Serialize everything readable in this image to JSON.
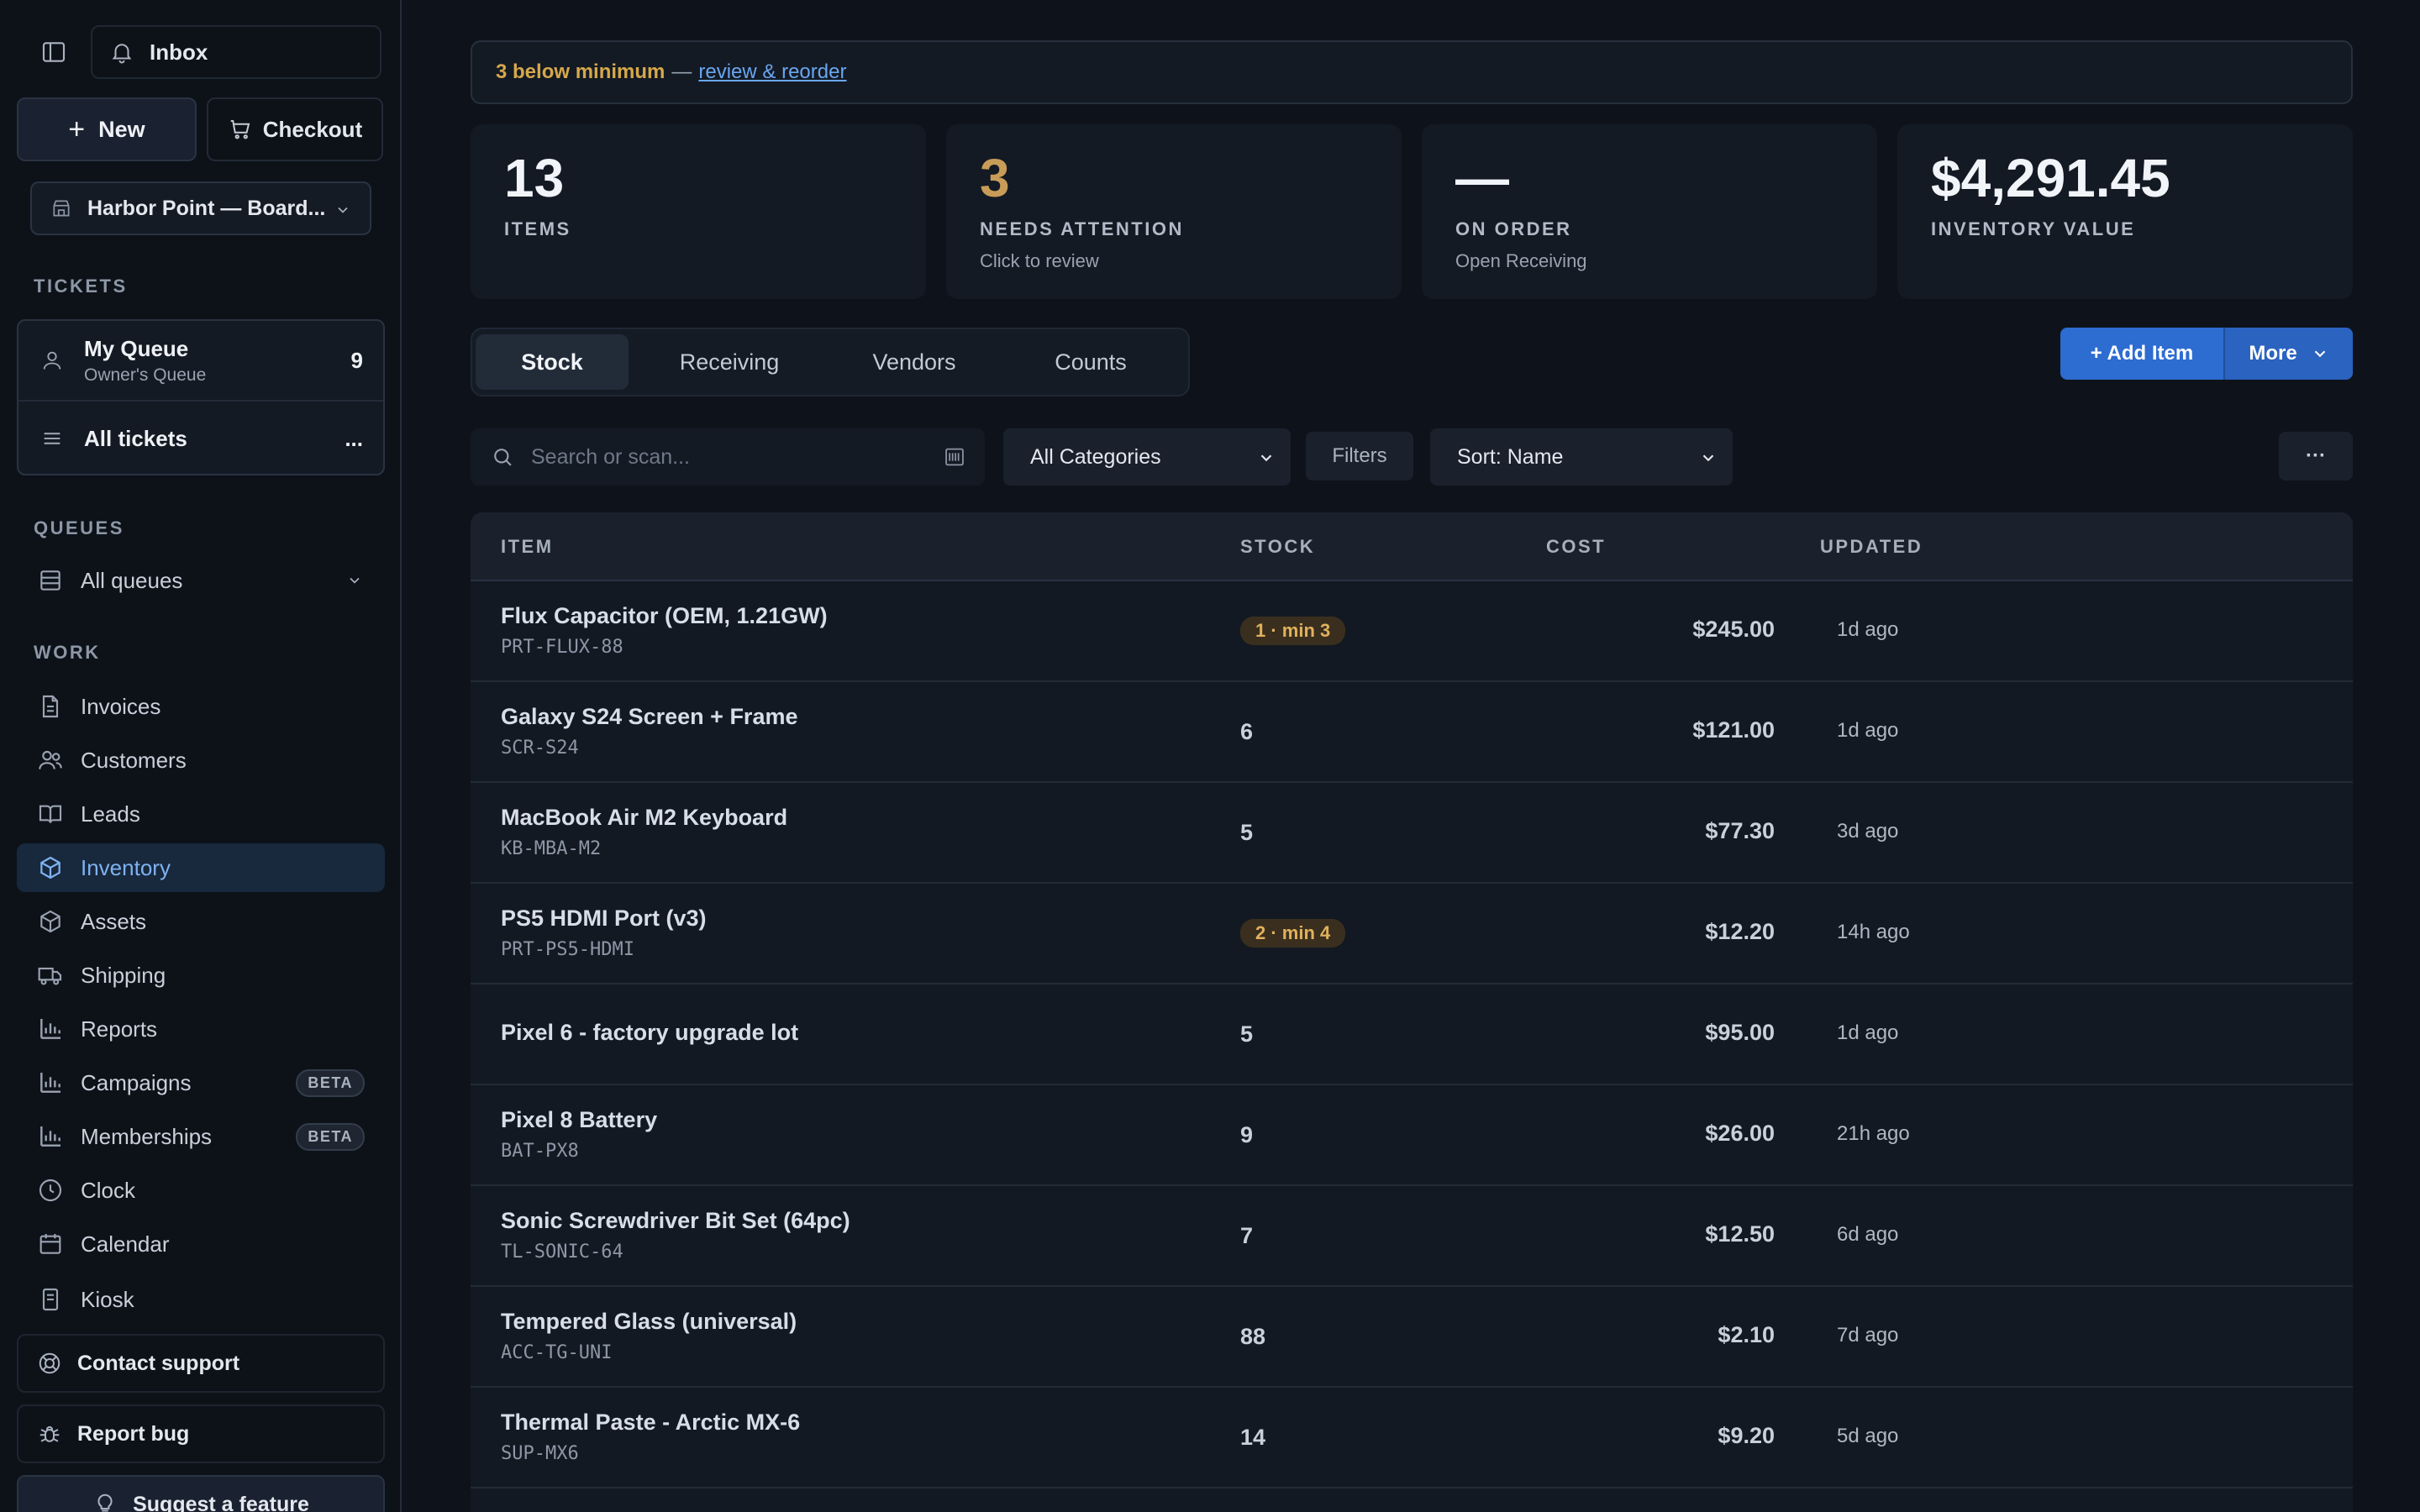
{
  "sidebar": {
    "inbox_label": "Inbox",
    "new_label": "New",
    "checkout_label": "Checkout",
    "location_label": "Harbor Point — Board...",
    "tickets_heading": "TICKETS",
    "my_queue": {
      "title": "My Queue",
      "subtitle": "Owner's Queue",
      "count": "9"
    },
    "all_tickets": {
      "label": "All tickets",
      "more": "..."
    },
    "queues_heading": "QUEUES",
    "all_queues_label": "All queues",
    "work_heading": "WORK",
    "nav": [
      {
        "label": "Invoices",
        "icon": "file-icon"
      },
      {
        "label": "Customers",
        "icon": "users-icon"
      },
      {
        "label": "Leads",
        "icon": "book-open-icon"
      },
      {
        "label": "Inventory",
        "icon": "box-icon",
        "active": true
      },
      {
        "label": "Assets",
        "icon": "cube-icon"
      },
      {
        "label": "Shipping",
        "icon": "truck-icon"
      },
      {
        "label": "Reports",
        "icon": "bar-chart-icon"
      },
      {
        "label": "Campaigns",
        "icon": "bar-chart-icon",
        "badge": "BETA"
      },
      {
        "label": "Memberships",
        "icon": "bar-chart-icon",
        "badge": "BETA"
      },
      {
        "label": "Clock",
        "icon": "clock-icon"
      },
      {
        "label": "Calendar",
        "icon": "calendar-icon"
      },
      {
        "label": "Kiosk",
        "icon": "tablet-icon"
      }
    ],
    "contact_support": "Contact support",
    "report_bug": "Report bug",
    "suggest_feature": "Suggest a feature"
  },
  "alert": {
    "warning": "3 below minimum",
    "separator": "—",
    "link": "review & reorder"
  },
  "stats": [
    {
      "value": "13",
      "label": "ITEMS",
      "sub": ""
    },
    {
      "value": "3",
      "label": "NEEDS ATTENTION",
      "sub": "Click to review"
    },
    {
      "value": "—",
      "label": "ON ORDER",
      "sub": "Open Receiving"
    },
    {
      "value": "$4,291.45",
      "label": "INVENTORY VALUE",
      "sub": ""
    }
  ],
  "tabs": [
    {
      "label": "Stock",
      "active": true
    },
    {
      "label": "Receiving"
    },
    {
      "label": "Vendors"
    },
    {
      "label": "Counts"
    }
  ],
  "actions": {
    "add_item": "+ Add Item",
    "more": "More"
  },
  "toolbar": {
    "search_placeholder": "Search or scan...",
    "category": "All Categories",
    "filters": "Filters",
    "sort": "Sort: Name",
    "overflow": "···"
  },
  "table": {
    "headers": {
      "item": "ITEM",
      "stock": "STOCK",
      "cost": "COST",
      "updated": "UPDATED"
    },
    "rows": [
      {
        "name": "Flux Capacitor (OEM, 1.21GW)",
        "sku": "PRT-FLUX-88",
        "stock": "1 · min 3",
        "low": true,
        "cost": "$245.00",
        "updated": "1d ago"
      },
      {
        "name": "Galaxy S24 Screen + Frame",
        "sku": "SCR-S24",
        "stock": "6",
        "cost": "$121.00",
        "updated": "1d ago"
      },
      {
        "name": "MacBook Air M2 Keyboard",
        "sku": "KB-MBA-M2",
        "stock": "5",
        "cost": "$77.30",
        "updated": "3d ago"
      },
      {
        "name": "PS5 HDMI Port (v3)",
        "sku": "PRT-PS5-HDMI",
        "stock": "2 · min 4",
        "low": true,
        "cost": "$12.20",
        "updated": "14h ago"
      },
      {
        "name": "Pixel 6 - factory upgrade lot",
        "sku": "",
        "stock": "5",
        "cost": "$95.00",
        "updated": "1d ago"
      },
      {
        "name": "Pixel 8 Battery",
        "sku": "BAT-PX8",
        "stock": "9",
        "cost": "$26.00",
        "updated": "21h ago"
      },
      {
        "name": "Sonic Screwdriver Bit Set (64pc)",
        "sku": "TL-SONIC-64",
        "stock": "7",
        "cost": "$12.50",
        "updated": "6d ago"
      },
      {
        "name": "Tempered Glass (universal)",
        "sku": "ACC-TG-UNI",
        "stock": "88",
        "cost": "$2.10",
        "updated": "7d ago"
      },
      {
        "name": "Thermal Paste - Arctic MX-6",
        "sku": "SUP-MX6",
        "stock": "14",
        "cost": "$9.20",
        "updated": "5d ago"
      }
    ]
  }
}
